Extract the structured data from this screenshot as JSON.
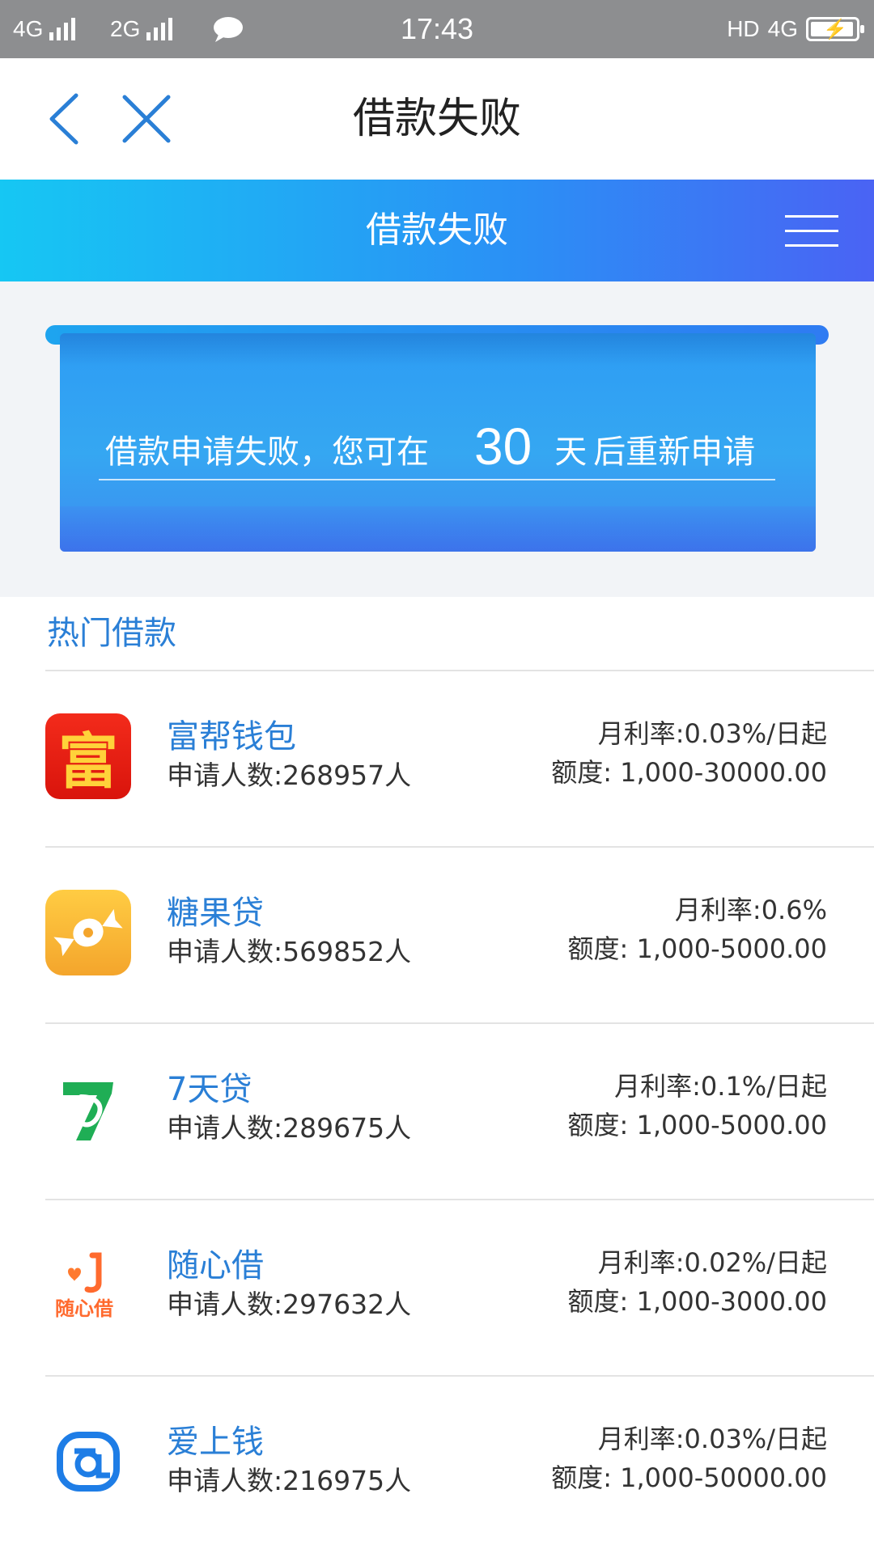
{
  "status_bar": {
    "network1": "4G",
    "network2": "2G",
    "time": "17:43",
    "hd": "HD",
    "network3": "4G"
  },
  "nav": {
    "title": "借款失败"
  },
  "header": {
    "title": "借款失败"
  },
  "banner": {
    "text_before": "借款申请失败，您可在",
    "days": "30",
    "text_after_unit": "天",
    "text_after": "后重新申请"
  },
  "hot_section": {
    "title": "热门借款"
  },
  "loans": [
    {
      "name": "富帮钱包",
      "applicants": "申请人数:268957人",
      "rate": "月利率:0.03%/日起",
      "quota": "额度: 1,000-30000.00",
      "logo_text": "富"
    },
    {
      "name": "糖果贷",
      "applicants": "申请人数:569852人",
      "rate": "月利率:0.6%",
      "quota": "额度: 1,000-5000.00"
    },
    {
      "name": "7天贷",
      "applicants": "申请人数:289675人",
      "rate": "月利率:0.1%/日起",
      "quota": "额度: 1,000-5000.00"
    },
    {
      "name": "随心借",
      "applicants": "申请人数:297632人",
      "rate": "月利率:0.02%/日起",
      "quota": "额度: 1,000-3000.00",
      "logo_text": "随心借"
    },
    {
      "name": "爱上钱",
      "applicants": "申请人数:216975人",
      "rate": "月利率:0.03%/日起",
      "quota": "额度: 1,000-50000.00"
    }
  ],
  "colors": {
    "accent": "#2a7fd6",
    "header_gradient_start": "#16c7f3",
    "header_gradient_end": "#4a63f4"
  }
}
